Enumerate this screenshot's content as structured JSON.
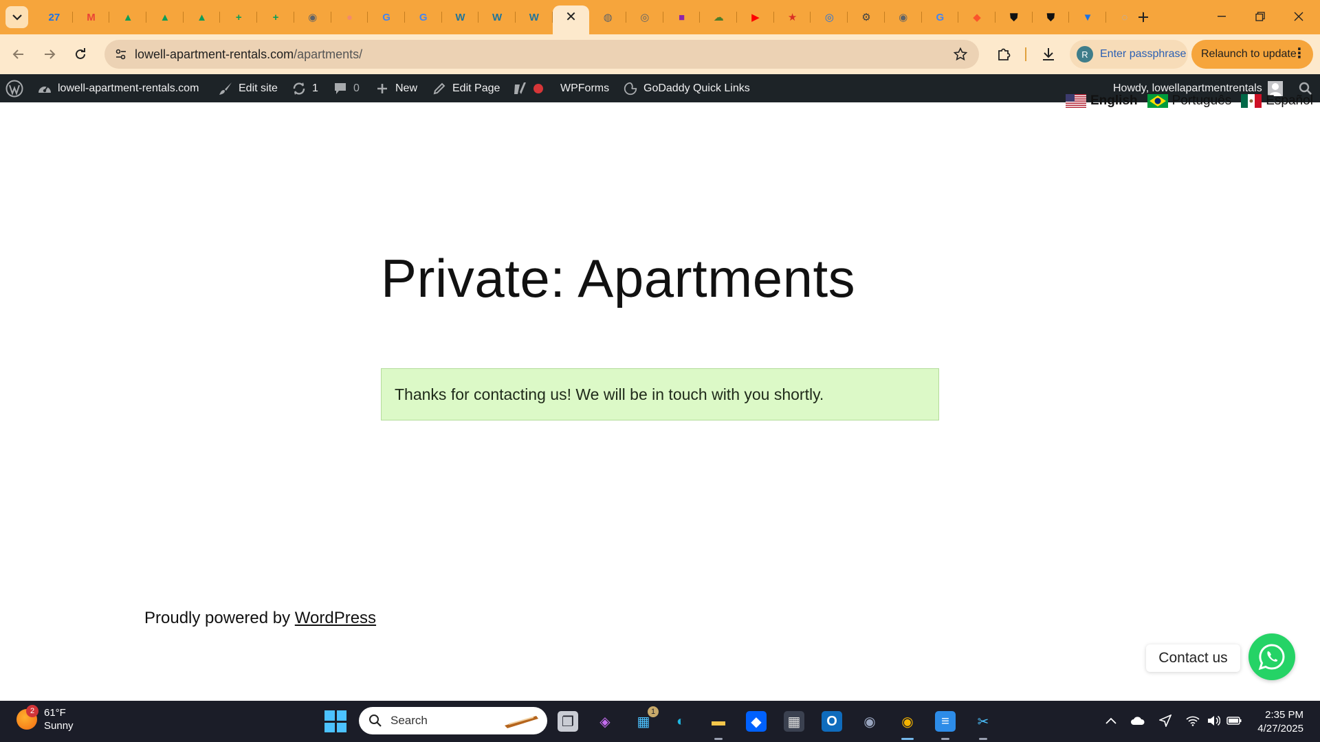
{
  "browser": {
    "tabs": [
      {
        "icon": "calendar-icon",
        "color": "#1a73e8",
        "glyph": "27"
      },
      {
        "icon": "gmail-icon",
        "color": "#ea4335",
        "glyph": "M"
      },
      {
        "icon": "drive-icon",
        "color": "#0f9d58",
        "glyph": "▲"
      },
      {
        "icon": "drive-icon",
        "color": "#0f9d58",
        "glyph": "▲"
      },
      {
        "icon": "drive-icon",
        "color": "#0f9d58",
        "glyph": "▲"
      },
      {
        "icon": "sheets-icon",
        "color": "#0f9d58",
        "glyph": "+"
      },
      {
        "icon": "sheets-icon",
        "color": "#0f9d58",
        "glyph": "+"
      },
      {
        "icon": "chrome-icon",
        "color": "#5f6368",
        "glyph": "◉"
      },
      {
        "icon": "generic-site-icon",
        "color": "#f28b6c",
        "glyph": "●"
      },
      {
        "icon": "google-icon",
        "color": "#4285f4",
        "glyph": "G"
      },
      {
        "icon": "google-icon",
        "color": "#4285f4",
        "glyph": "G"
      },
      {
        "icon": "wordpress-icon",
        "color": "#21759b",
        "glyph": "W"
      },
      {
        "icon": "wordpress-icon",
        "color": "#21759b",
        "glyph": "W"
      },
      {
        "icon": "wordpress-icon",
        "color": "#21759b",
        "glyph": "W"
      },
      {
        "icon": "close-icon",
        "color": "#222222",
        "glyph": "✕",
        "active": true
      },
      {
        "icon": "globe-icon",
        "color": "#5f6368",
        "glyph": "◍"
      },
      {
        "icon": "chrome-icon",
        "color": "#5f6368",
        "glyph": "◎"
      },
      {
        "icon": "app-icon",
        "color": "#8e24aa",
        "glyph": "■"
      },
      {
        "icon": "cloud-icon",
        "color": "#4e7d2b",
        "glyph": "☁"
      },
      {
        "icon": "youtube-icon",
        "color": "#ff0000",
        "glyph": "▶"
      },
      {
        "icon": "star-icon",
        "color": "#d93025",
        "glyph": "★"
      },
      {
        "icon": "target-icon",
        "color": "#1a73e8",
        "glyph": "◎"
      },
      {
        "icon": "settings-icon",
        "color": "#3c4043",
        "glyph": "⚙"
      },
      {
        "icon": "chrome-icon",
        "color": "#5f6368",
        "glyph": "◉"
      },
      {
        "icon": "google-icon",
        "color": "#4285f4",
        "glyph": "G"
      },
      {
        "icon": "brave-icon",
        "color": "#fb542b",
        "glyph": "◆"
      },
      {
        "icon": "shield-icon",
        "color": "#111111",
        "glyph": "⛊"
      },
      {
        "icon": "shield-icon",
        "color": "#111111",
        "glyph": "⛊"
      },
      {
        "icon": "filter-icon",
        "color": "#1a73e8",
        "glyph": "▼"
      },
      {
        "icon": "loading-icon",
        "color": "#8ab4f8",
        "glyph": "◌"
      }
    ],
    "url_host": "lowell-apartment-rentals.com",
    "url_path": "/apartments/",
    "passphrase_label": "Enter passphrase",
    "profile_initial": "R",
    "relaunch_label": "Relaunch to update"
  },
  "adminbar": {
    "site_name": "lowell-apartment-rentals.com",
    "edit_site": "Edit site",
    "updates_count": "1",
    "comments_count": "0",
    "new_label": "New",
    "edit_page": "Edit Page",
    "wpforms": "WPForms",
    "godaddy": "GoDaddy Quick Links",
    "howdy": "Howdy, lowellapartmentrentals"
  },
  "languages": [
    {
      "label": "English",
      "current": true
    },
    {
      "label": "Português",
      "current": false
    },
    {
      "label": "Español",
      "current": false
    }
  ],
  "page": {
    "title": "Private: Apartments",
    "notice": "Thanks for contacting us! We will be in touch with you shortly.",
    "footer_prefix": "Proudly powered by ",
    "footer_link": "WordPress",
    "contact_label": "Contact us"
  },
  "taskbar": {
    "temperature": "61°F",
    "condition": "Sunny",
    "weather_badge": "2",
    "search_placeholder": "Search",
    "store_badge": "1",
    "time": "2:35 PM",
    "date": "4/27/2025"
  },
  "colors": {
    "tabstrip": "#f6a53c",
    "toolbar": "#fde9cc",
    "adminbar": "#1d2327",
    "notice_bg": "#dcf9c7",
    "whatsapp": "#25d366",
    "taskbar": "#1b1d28"
  }
}
